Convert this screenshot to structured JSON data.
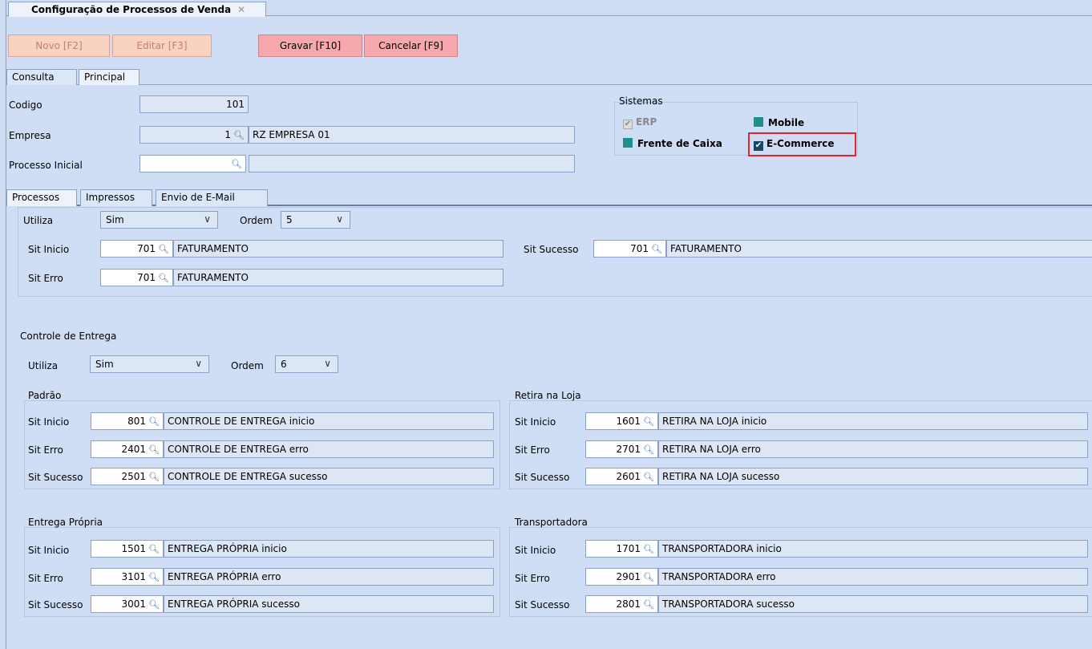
{
  "window": {
    "tab_title": "Configuração de Processos de Venda",
    "close_glyph": "✕"
  },
  "toolbar": {
    "new_label": "Novo [F2]",
    "edit_label": "Editar [F3]",
    "save_label": "Gravar [F10]",
    "cancel_label": "Cancelar [F9]"
  },
  "primary_tabs": [
    "Consulta",
    "Principal"
  ],
  "form": {
    "codigo_label": "Codigo",
    "codigo_value": "101",
    "empresa_label": "Empresa",
    "empresa_code": "1",
    "empresa_name": "RZ EMPRESA 01",
    "processo_label": "Processo Inicial",
    "processo_value": "",
    "processo_desc": ""
  },
  "sistemas": {
    "title": "Sistemas",
    "erp": "ERP",
    "mobile": "Mobile",
    "frente_caixa": "Frente de Caixa",
    "ecommerce": "E-Commerce"
  },
  "sub_tabs": [
    "Processos",
    "Impressos",
    "Envio de E-Mail"
  ],
  "processos": {
    "utiliza_label": "Utiliza",
    "utiliza_value": "Sim",
    "ordem_label": "Ordem",
    "ordem_value": "5",
    "sit_inicio_label": "Sit Inicio",
    "sit_inicio_code": "701",
    "sit_inicio_desc": "FATURAMENTO",
    "sit_erro_label": "Sit Erro",
    "sit_erro_code": "701",
    "sit_erro_desc": "FATURAMENTO",
    "sit_sucesso_label": "Sit Sucesso",
    "sit_sucesso_code": "701",
    "sit_sucesso_desc": "FATURAMENTO"
  },
  "controle": {
    "title": "Controle de Entrega",
    "utiliza_label": "Utiliza",
    "utiliza_value": "Sim",
    "ordem_label": "Ordem",
    "ordem_value": "6",
    "groups": {
      "padrao": {
        "title": "Padrão",
        "rows": [
          {
            "label": "Sit Inicio",
            "code": "801",
            "desc": "CONTROLE DE ENTREGA inicio"
          },
          {
            "label": "Sit Erro",
            "code": "2401",
            "desc": "CONTROLE DE ENTREGA erro"
          },
          {
            "label": "Sit Sucesso",
            "code": "2501",
            "desc": "CONTROLE DE ENTREGA sucesso"
          }
        ]
      },
      "retira": {
        "title": "Retira na Loja",
        "rows": [
          {
            "label": "Sit Inicio",
            "code": "1601",
            "desc": "RETIRA NA LOJA inicio"
          },
          {
            "label": "Sit Erro",
            "code": "2701",
            "desc": "RETIRA NA LOJA erro"
          },
          {
            "label": "Sit Sucesso",
            "code": "2601",
            "desc": "RETIRA NA LOJA sucesso"
          }
        ]
      },
      "propria": {
        "title": "Entrega Própria",
        "rows": [
          {
            "label": "Sit Inicio",
            "code": "1501",
            "desc": "ENTREGA PRÓPRIA inicio"
          },
          {
            "label": "Sit Erro",
            "code": "3101",
            "desc": "ENTREGA PRÓPRIA erro"
          },
          {
            "label": "Sit Sucesso",
            "code": "3001",
            "desc": "ENTREGA PRÓPRIA sucesso"
          }
        ]
      },
      "transportadora": {
        "title": "Transportadora",
        "rows": [
          {
            "label": "Sit Inicio",
            "code": "1701",
            "desc": "TRANSPORTADORA inicio"
          },
          {
            "label": "Sit Erro",
            "code": "2901",
            "desc": "TRANSPORTADORA erro"
          },
          {
            "label": "Sit Sucesso",
            "code": "2801",
            "desc": "TRANSPORTADORA sucesso"
          }
        ]
      }
    }
  },
  "icons": {
    "lookup": "search-icon",
    "dropdown": "chevron-down-icon",
    "check": "✔",
    "chevron": "∨",
    "magnifier": "🔍︎"
  },
  "colors": {
    "background": "#d0def5",
    "action_button": "#f6a8ad",
    "disabled_button": "#f8d3bf",
    "highlight": "#e0252f",
    "system_marker": "#1f8f8b"
  }
}
